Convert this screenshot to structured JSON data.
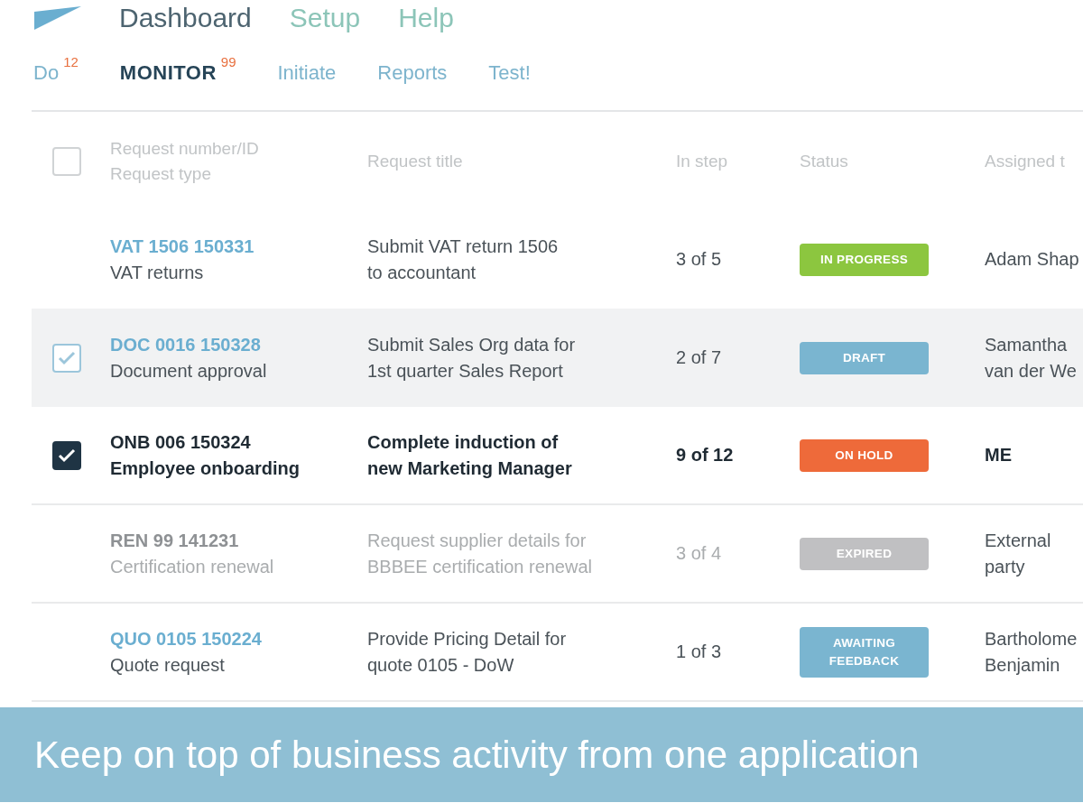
{
  "top_nav": [
    {
      "label": "Dashboard",
      "selected": true
    },
    {
      "label": "Setup",
      "selected": false
    },
    {
      "label": "Help",
      "selected": false
    }
  ],
  "tabs": [
    {
      "label": "Do",
      "count": "12",
      "selected": false
    },
    {
      "label": "MONITOR",
      "count": "99",
      "selected": true
    },
    {
      "label": "Initiate",
      "selected": false
    },
    {
      "label": "Reports",
      "selected": false
    },
    {
      "label": "Test!",
      "selected": false
    }
  ],
  "table": {
    "select_all": {
      "checked": false
    },
    "columns": [
      {
        "lines": [
          "Request number/ID",
          "Request type"
        ]
      },
      {
        "lines": [
          "Request title"
        ]
      },
      {
        "lines": [
          "In step"
        ]
      },
      {
        "lines": [
          "Status"
        ]
      },
      {
        "lines": [
          "Assigned t"
        ]
      }
    ],
    "rows": [
      {
        "id": "VAT 1506 150331",
        "type": "VAT returns",
        "title": [
          "Submit VAT return 1506",
          "to accountant"
        ],
        "step": "3 of 5",
        "status": "IN PROGRESS",
        "color": "#8cc63f",
        "assigned": [
          "Adam Shap"
        ],
        "checked": false,
        "selected": false,
        "hovered": false,
        "disabled": false
      },
      {
        "id": "DOC 0016 150328",
        "type": "Document approval",
        "title": [
          "Submit Sales Org data for",
          "1st quarter Sales Report"
        ],
        "step": "2 of 7",
        "status": "DRAFT",
        "color": "#7ab5d0",
        "assigned": [
          "Samantha",
          "van der We"
        ],
        "checked": true,
        "selected": false,
        "hovered": true,
        "disabled": false
      },
      {
        "id": "ONB 006 150324",
        "type": "Employee onboarding",
        "title": [
          "Complete induction of",
          "new Marketing Manager"
        ],
        "step": "9 of 12",
        "status": "ON HOLD",
        "color": "#ee6a3a",
        "assigned": [
          "ME"
        ],
        "checked": true,
        "selected": true,
        "hovered": false,
        "disabled": false
      },
      {
        "id": "REN 99 141231",
        "type": "Certification renewal",
        "title": [
          "Request supplier details for",
          "BBBEE certification renewal"
        ],
        "step": "3 of 4",
        "status": "EXPIRED",
        "color": "#c0c0c2",
        "assigned": [
          "External",
          "party"
        ],
        "checked": false,
        "selected": false,
        "hovered": false,
        "disabled": true
      },
      {
        "id": "QUO 0105 150224",
        "type": "Quote request",
        "title": [
          "Provide Pricing Detail for",
          "quote 0105 - DoW"
        ],
        "step": "1 of 3",
        "status": "AWAITING FEEDBACK",
        "color": "#7ab5d0",
        "assigned": [
          "Bartholome",
          "Benjamin"
        ],
        "checked": false,
        "selected": false,
        "hovered": false,
        "disabled": false
      }
    ]
  },
  "caption": "Keep on top of business activity from one application"
}
